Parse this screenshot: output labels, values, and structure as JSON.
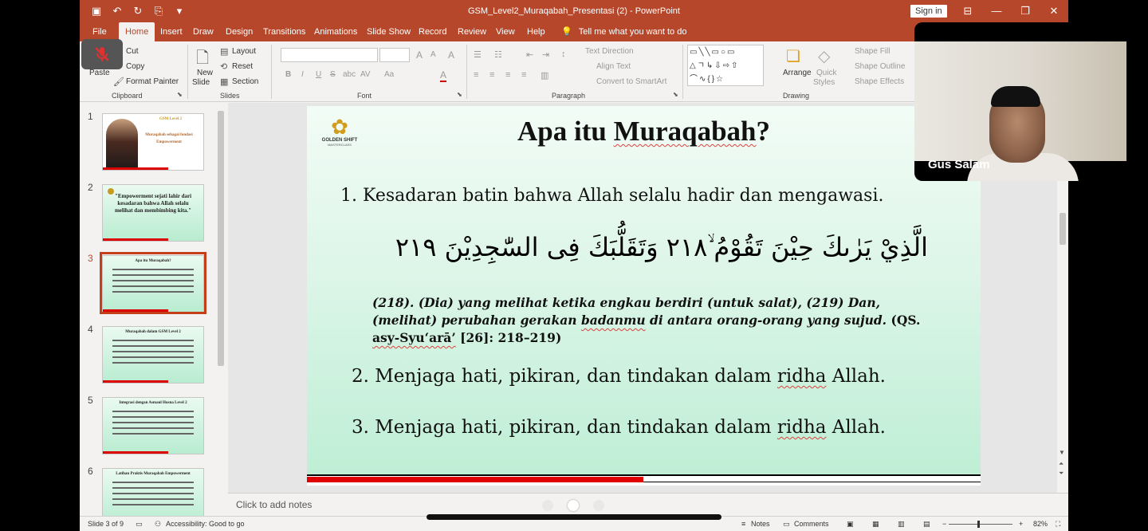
{
  "titlebar": {
    "doc_title": "GSM_Level2_Muraqabah_Presentasi (2)  -  PowerPoint",
    "signin": "Sign in",
    "qat": [
      "▣",
      "↶",
      "↻",
      "⎘",
      "▾"
    ],
    "winctl": [
      "⊟",
      "—",
      "❐",
      "✕"
    ]
  },
  "tabs": {
    "items": [
      "File",
      "Home",
      "Insert",
      "Draw",
      "Design",
      "Transitions",
      "Animations",
      "Slide Show",
      "Record",
      "Review",
      "View",
      "Help"
    ],
    "active": "Home",
    "tellme": "Tell me what you want to do"
  },
  "ribbon": {
    "clipboard": {
      "paste": "Paste",
      "cut": "Cut",
      "copy": "Copy",
      "format_painter": "Format Painter",
      "label": "Clipboard"
    },
    "slides": {
      "new_slide": "New",
      "new_slide2": "Slide",
      "layout": "Layout",
      "reset": "Reset",
      "section": "Section",
      "label": "Slides"
    },
    "font": {
      "label": "Font",
      "bold": "B",
      "italic": "I",
      "underline": "U",
      "strike": "S",
      "shadow": "abc",
      "spacing": "AV",
      "case": "Aa",
      "color": "A",
      "grow": "A",
      "shrink": "A",
      "clear": "A"
    },
    "paragraph": {
      "label": "Paragraph",
      "text_direction": "Text Direction",
      "align_text": "Align Text",
      "convert_smartart": "Convert to SmartArt"
    },
    "drawing": {
      "label": "Drawing",
      "arrange": "Arrange",
      "quick": "Quick",
      "styles": "Styles",
      "shape_fill": "Shape Fill",
      "shape_outline": "Shape Outline",
      "shape_effects": "Shape Effects",
      "shapes_glyphs": [
        "▭╲╲▭○▭",
        "△ㄱ↳⇩⇨⇧",
        "⌒∿{}☆"
      ]
    }
  },
  "thumbnails": [
    {
      "num": "1",
      "title": "GSM Level 2",
      "text": "Muraqabah sebagai fondasi Empowerment"
    },
    {
      "num": "2",
      "title": "",
      "text": "\"Empowerment sejati lahir dari kesadaran bahwa Allah selalu melihat dan membimbing kita.\""
    },
    {
      "num": "3",
      "title": "Apa itu Muraqabah?",
      "text": ""
    },
    {
      "num": "4",
      "title": "Muraqabah dalam GSM Level 2",
      "text": ""
    },
    {
      "num": "5",
      "title": "Integrasi dengan Asmaul Husna Level 2",
      "text": ""
    },
    {
      "num": "6",
      "title": "Latihan Praktis Muraqabah Empowerment",
      "text": ""
    }
  ],
  "slide": {
    "logo_line1": "GOLDEN SHIFT",
    "logo_line2": "MASTERCLASS",
    "title_part1": "Apa itu ",
    "title_part2": "Muraqabah",
    "title_part3": "?",
    "item1": "1.  Kesadaran batin bahwa Allah selalu hadir dan mengawasi.",
    "arabic": "الَّذِيْ يَرٰىكَ حِيْنَ تَقُوْمُ ۙ٢١٨ وَتَقَلُّبَكَ فِى السّٰجِدِيْنَ ٢١٩",
    "translation_a": "(218). (Dia) yang melihat ketika engkau berdiri (untuk salat), (219) Dan, (melihat) perubahan gerakan ",
    "translation_b": "badanmu",
    "translation_c": " di antara orang-orang yang sujud.",
    "translation_ref_a": " (QS. ",
    "translation_ref_b": "asy-Syu‘arā’",
    "translation_ref_c": " [26]: 218–219)",
    "item2_a": "2. Menjaga hati, pikiran, dan tindakan dalam ",
    "item2_b": "ridha",
    "item2_c": " Allah.",
    "item3_a": "3. Menjaga hati, pikiran, dan tindakan dalam ",
    "item3_b": "ridha",
    "item3_c": " Allah."
  },
  "notes": {
    "placeholder": "Click to add notes"
  },
  "status": {
    "slide_count": "Slide 3 of 9",
    "accessibility": "Accessibility: Good to go",
    "notes": "Notes",
    "comments": "Comments",
    "zoom": "82%"
  },
  "video": {
    "participant": "Gus Salam"
  }
}
